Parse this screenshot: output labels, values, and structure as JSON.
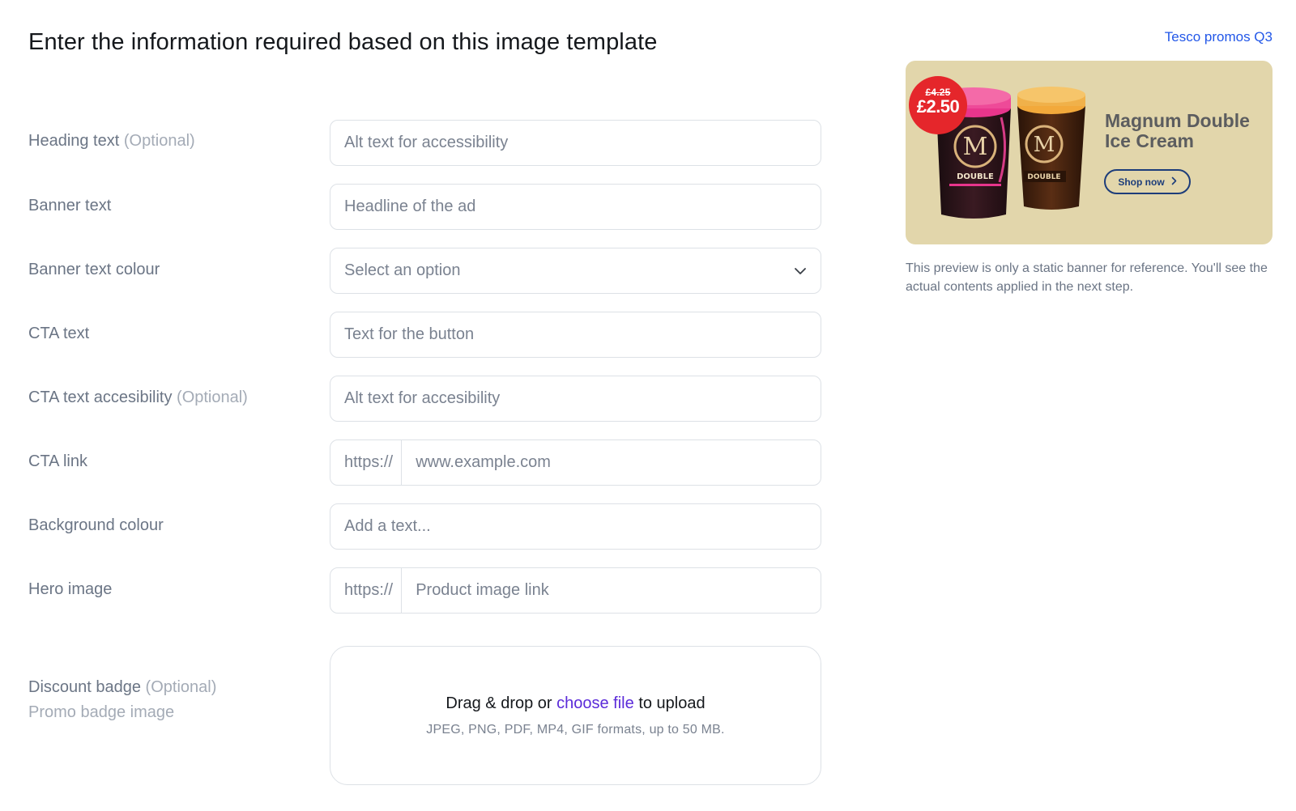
{
  "page": {
    "title": "Enter the information required based on this image template"
  },
  "form": {
    "fields": [
      {
        "label": "Heading text",
        "optional": "(Optional)",
        "placeholder": "Alt text for accessibility"
      },
      {
        "label": "Banner text",
        "placeholder": "Headline of the ad"
      },
      {
        "label": "Banner text colour",
        "select_value": "Select an option"
      },
      {
        "label": "CTA text",
        "placeholder": "Text for the button"
      },
      {
        "label": "CTA text accesibility",
        "optional": "(Optional)",
        "placeholder": "Alt text for accesibility"
      },
      {
        "label": "CTA link",
        "prefix": "https://",
        "placeholder": "www.example.com"
      },
      {
        "label": "Background colour",
        "placeholder": "Add a text..."
      },
      {
        "label": "Hero image",
        "prefix": "https://",
        "placeholder": "Product image link"
      },
      {
        "label": "Discount badge",
        "optional": "(Optional)",
        "sub": "Promo badge image"
      }
    ],
    "upload": {
      "prefix_text": "Drag & drop or",
      "link_text": "choose file",
      "suffix_text": "to upload",
      "hint": "JPEG, PNG, PDF, MP4, GIF formats, up to 50 MB."
    }
  },
  "sidebar": {
    "campaign_link": "Tesco promos Q3",
    "preview": {
      "badge_old_price": "£4.25",
      "badge_new_price": "£2.50",
      "title": "Magnum Double Ice Cream",
      "cta": "Shop now",
      "tub_labels": [
        "DOUBLE",
        "DOUBLE"
      ],
      "brand": "MAGNUM"
    },
    "note": "This preview is only a static banner for reference. You'll see the actual contents applied in the next step."
  },
  "colors": {
    "link_blue": "#2257e8",
    "choose_file_purple": "#5b2bd9",
    "preview_bg": "#e2d6ab",
    "badge_red": "#e5262b",
    "cta_navy": "#1d3d7a"
  },
  "icons": {
    "select": "chevron-down-icon",
    "cta": "chevron-right-icon"
  }
}
